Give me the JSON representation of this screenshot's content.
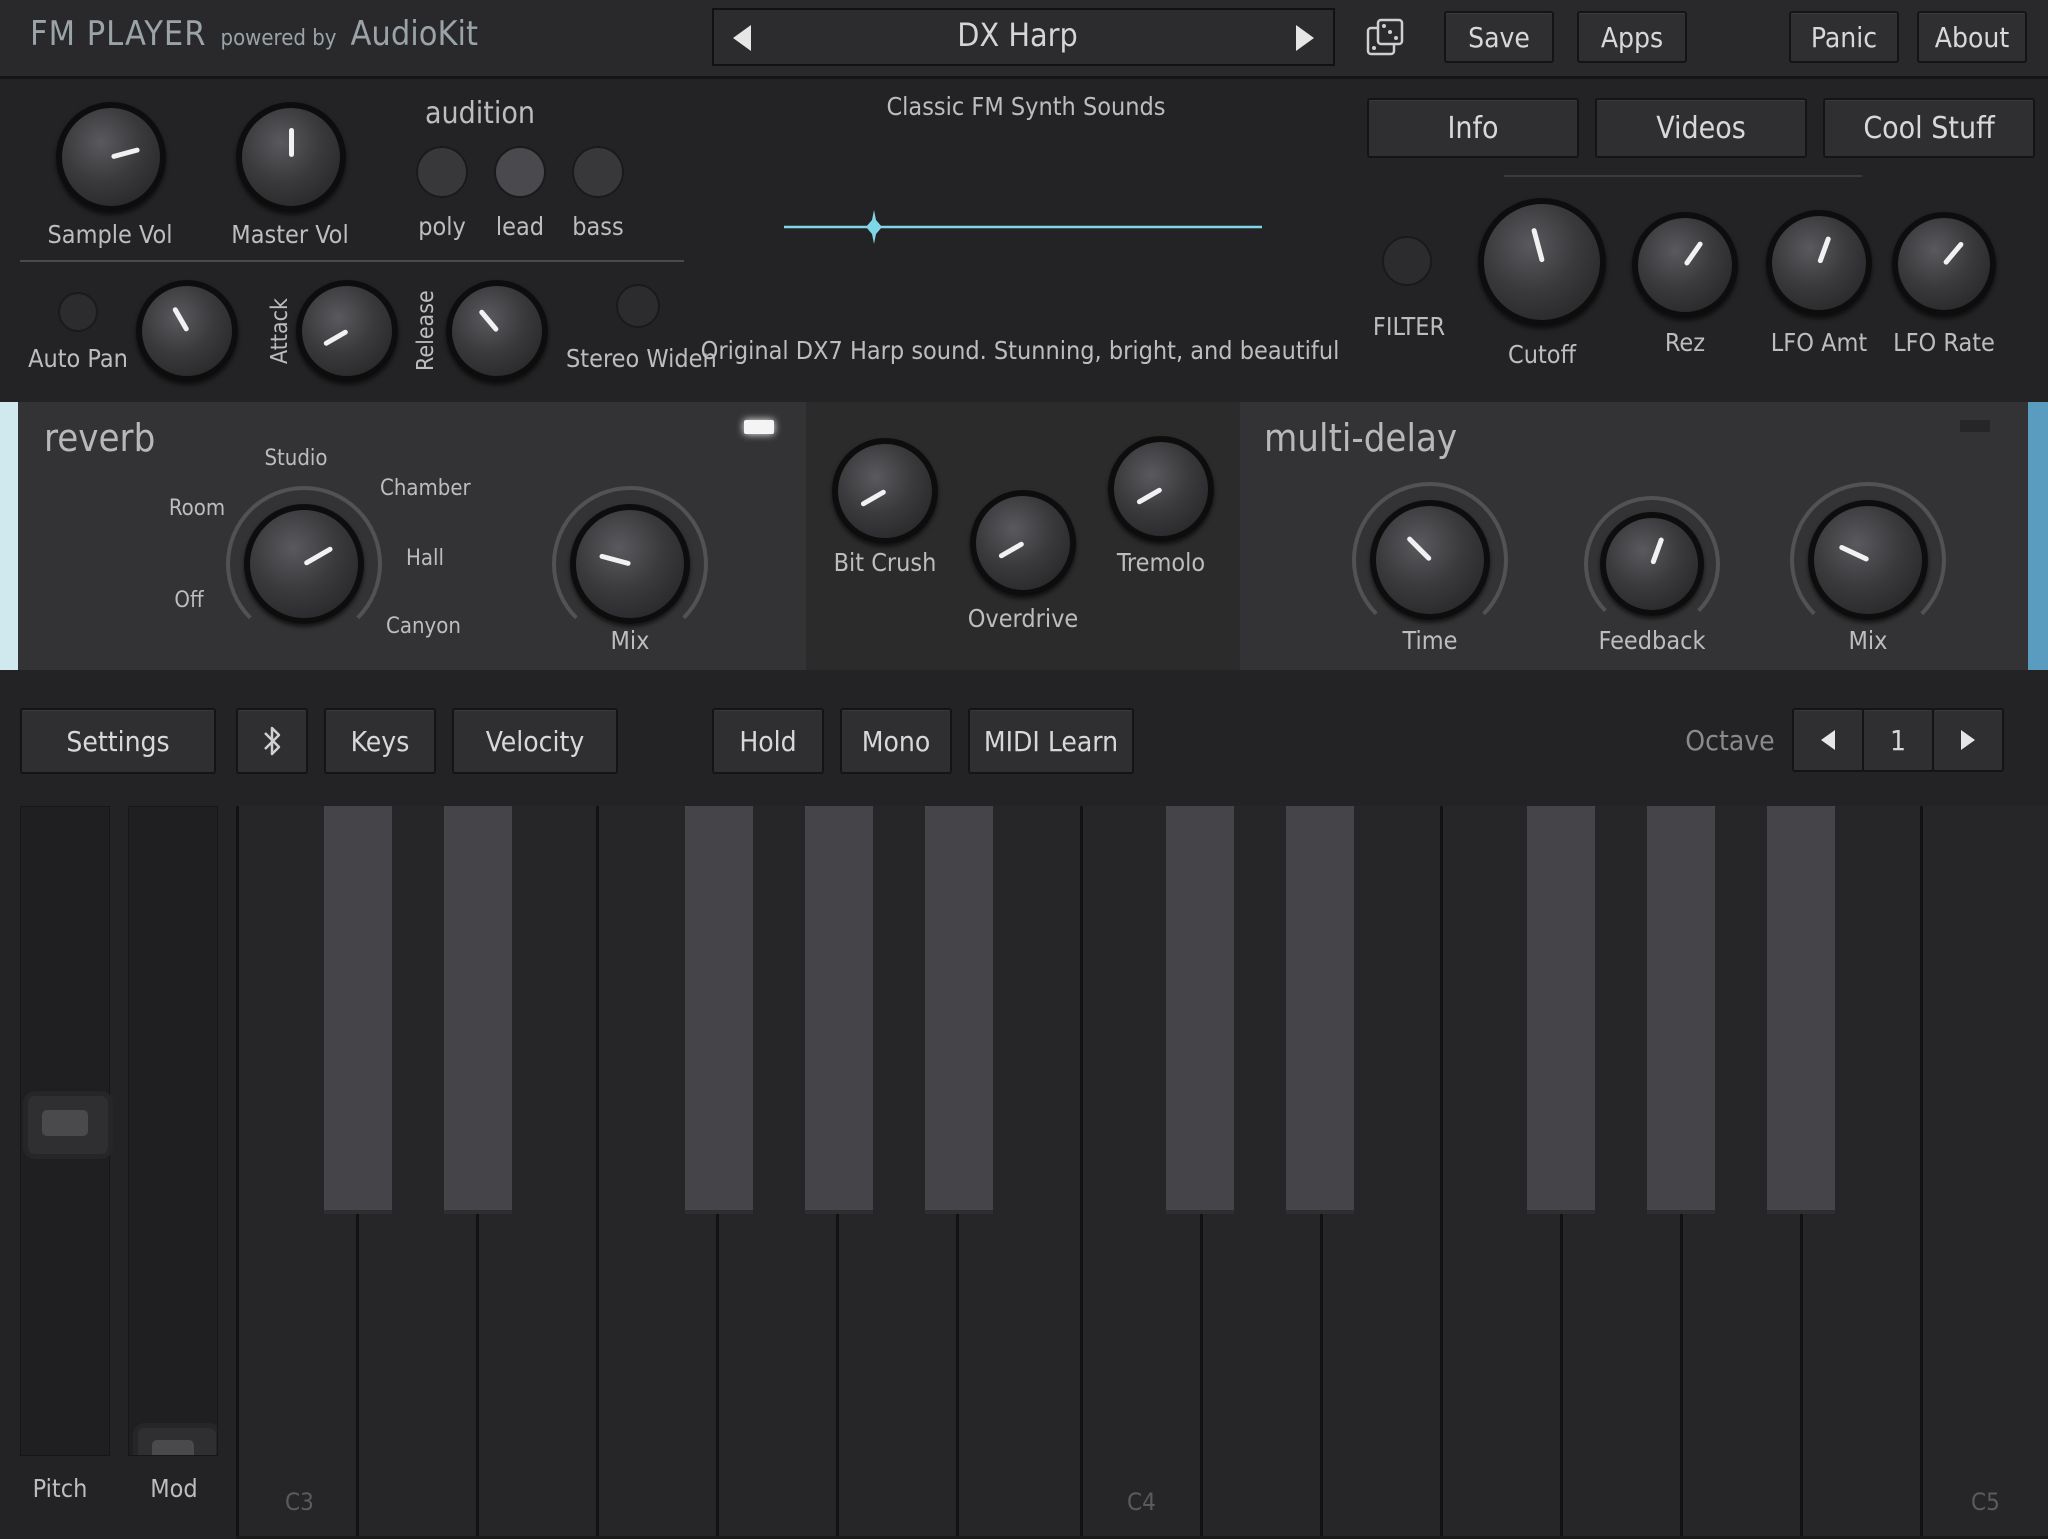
{
  "header": {
    "logo_main": "FM PLAYER",
    "logo_powered": "powered by",
    "logo_brand": "AudioKit",
    "preset_name": "DX Harp",
    "save_label": "Save",
    "apps_label": "Apps",
    "panic_label": "Panic",
    "about_label": "About"
  },
  "controls": {
    "sample_vol": "Sample Vol",
    "master_vol": "Master Vol",
    "audition_title": "audition",
    "audition": [
      "poly",
      "lead",
      "bass"
    ],
    "auto_pan": "Auto Pan",
    "attack": "Attack",
    "release": "Release",
    "stereo_widen": "Stereo Widen"
  },
  "preset_info": {
    "bank": "Classic FM Synth Sounds",
    "description": "Original DX7 Harp sound. Stunning, bright, and beautiful"
  },
  "right_panel": {
    "info_label": "Info",
    "videos_label": "Videos",
    "cool_stuff_label": "Cool Stuff",
    "filter": "FILTER",
    "cutoff": "Cutoff",
    "rez": "Rez",
    "lfo_amt": "LFO Amt",
    "lfo_rate": "LFO Rate"
  },
  "reverb": {
    "title": "reverb",
    "types": [
      "Off",
      "Room",
      "Studio",
      "Chamber",
      "Hall",
      "Canyon"
    ],
    "mix": "Mix"
  },
  "fx": {
    "bit_crush": "Bit Crush",
    "overdrive": "Overdrive",
    "tremolo": "Tremolo"
  },
  "delay": {
    "title": "multi-delay",
    "time": "Time",
    "feedback": "Feedback",
    "mix": "Mix"
  },
  "toolbar": {
    "settings": "Settings",
    "keys": "Keys",
    "velocity": "Velocity",
    "hold": "Hold",
    "mono": "Mono",
    "midi_learn": "MIDI Learn",
    "octave_label": "Octave",
    "octave_value": "1"
  },
  "wheels": {
    "pitch": "Pitch",
    "mod": "Mod"
  },
  "keyboard": {
    "labels": [
      "C3",
      "C4",
      "C5"
    ]
  },
  "colors": {
    "accent": "#7fd6e6",
    "delay_accent": "#5a9cc0",
    "reverb_accent": "#cfe9ee"
  }
}
